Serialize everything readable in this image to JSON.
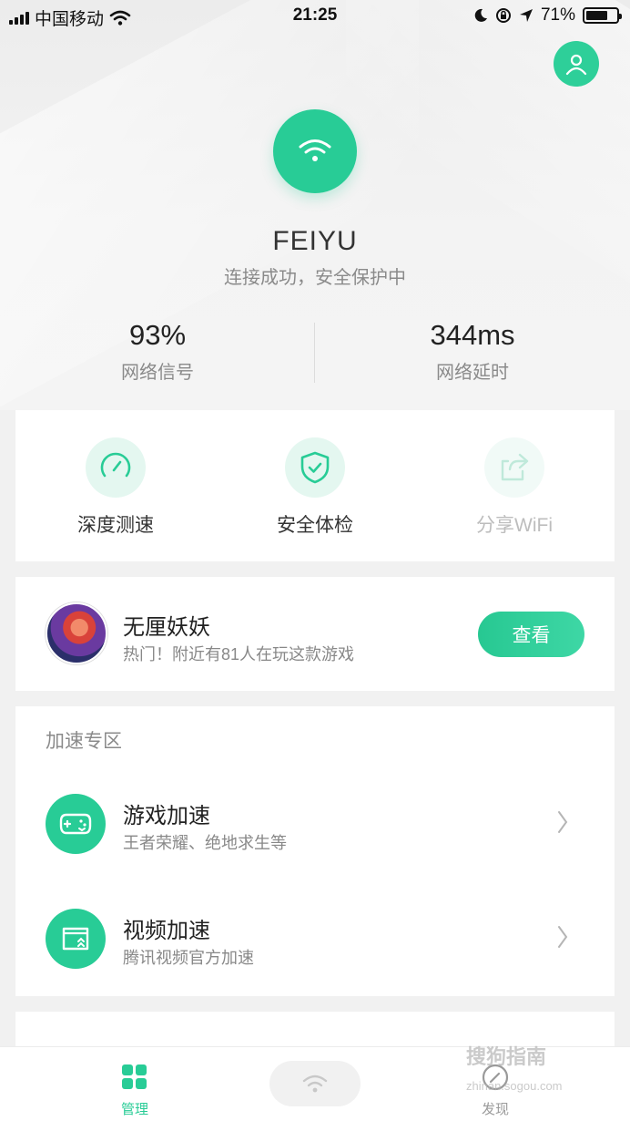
{
  "status_bar": {
    "carrier": "中国移动",
    "time": "21:25",
    "battery_percent": "71%"
  },
  "network": {
    "ssid": "FEIYU",
    "connection_status": "连接成功，安全保护中",
    "signal_value": "93%",
    "signal_label": "网络信号",
    "latency_value": "344ms",
    "latency_label": "网络延时"
  },
  "tools": [
    {
      "label": "深度测速",
      "icon": "speedometer-icon"
    },
    {
      "label": "安全体检",
      "icon": "shield-check-icon"
    },
    {
      "label": "分享WiFi",
      "icon": "share-icon"
    }
  ],
  "game_promo": {
    "name": "无厘妖妖",
    "description": "热门！附近有81人在玩这款游戏",
    "button_label": "查看"
  },
  "accelerate": {
    "heading": "加速专区",
    "items": [
      {
        "title": "游戏加速",
        "subtitle": "王者荣耀、绝地求生等",
        "icon": "gamepad-icon"
      },
      {
        "title": "视频加速",
        "subtitle": "腾讯视频官方加速",
        "icon": "video-box-icon"
      }
    ]
  },
  "tabbar": {
    "manage_label": "管理",
    "discover_label": "发现"
  },
  "watermark": {
    "main": "搜狗指南",
    "sub": "zhinan.sogou.com"
  },
  "colors": {
    "accent": "#28cc96",
    "accent_light": "#e4f7f0"
  }
}
